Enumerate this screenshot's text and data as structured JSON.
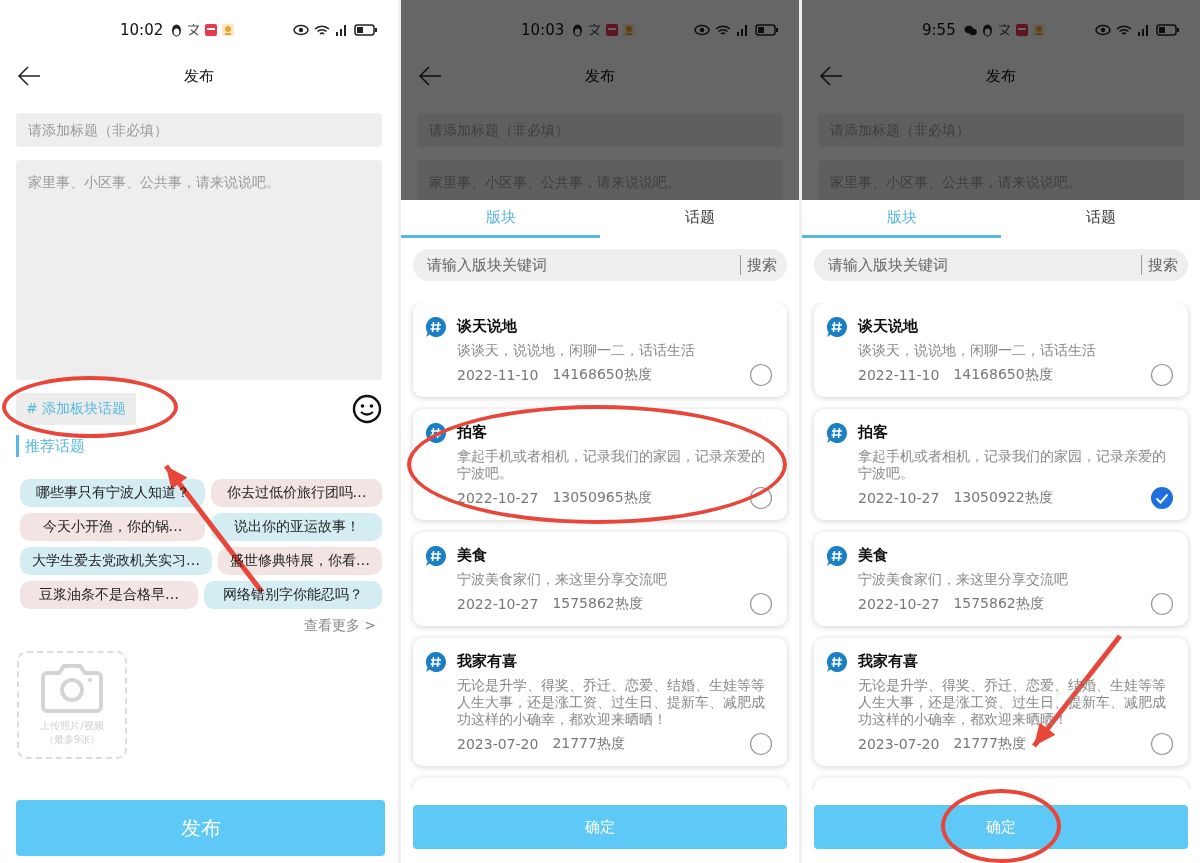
{
  "screens": [
    {
      "kind": "compose",
      "arrow": true,
      "status": {
        "time": "10:02",
        "notifications": [
          {
            "kind": "penguin"
          },
          {
            "kind": "translate"
          },
          {
            "kind": "news"
          },
          {
            "kind": "mascot"
          }
        ]
      },
      "header": {
        "title": "发布"
      },
      "title_field": {
        "placeholder": "请添加标题（非必填）"
      },
      "body_field": {
        "placeholder": "家里事、小区事、公共事，请来说说吧。"
      },
      "add_topic_button": {
        "label": "# 添加板块话题",
        "circled": true
      },
      "section_title": "推荐话题",
      "topic_rows": [
        [
          {
            "label": "哪些事只有宁波人知道？",
            "color": "#d4edf2"
          },
          {
            "label": "你去过低价旅行团吗…",
            "color": "#f3e4e4"
          }
        ],
        [
          {
            "label": "今天小开渔，你的锅…",
            "color": "#f3e4e4"
          },
          {
            "label": "说出你的亚运故事！",
            "color": "#d4edf2"
          }
        ],
        [
          {
            "label": "大学生爱去党政机关实习…",
            "color": "#d4edf2"
          },
          {
            "label": "盛世修典特展，你看…",
            "color": "#f3e4e4"
          }
        ],
        [
          {
            "label": "豆浆油条不是合格早…",
            "color": "#f3e4e4"
          },
          {
            "label": "网络错别字你能忍吗？",
            "color": "#d4edf2"
          }
        ]
      ],
      "more_link": "查看更多 >",
      "upload": {
        "line1": "上传照片/视频",
        "line2": "（最多9张）"
      },
      "publish_button": {
        "label": "发布"
      }
    },
    {
      "kind": "picker",
      "status": {
        "time": "10:03",
        "notifications": [
          {
            "kind": "penguin"
          },
          {
            "kind": "translate"
          },
          {
            "kind": "news"
          },
          {
            "kind": "mascot"
          }
        ]
      },
      "header": {
        "title": "发布"
      },
      "title_field": {
        "placeholder": "请添加标题（非必填）"
      },
      "body_field": {
        "placeholder": "家里事、小区事、公共事，请来说说吧。"
      },
      "tabs": [
        {
          "label": "版块",
          "selected": true
        },
        {
          "label": "话题",
          "selected": false
        }
      ],
      "search": {
        "placeholder": "请输入版块关键词",
        "button": "搜索"
      },
      "boards": [
        {
          "name": "谈天说地",
          "desc": "谈谈天，说说地，闲聊一二，话话生活",
          "date": "2022-11-10",
          "heat": "14168650热度",
          "selected": false,
          "circled": false
        },
        {
          "name": "拍客",
          "desc": "拿起手机或者相机，记录我们的家园，记录亲爱的宁波吧。",
          "date": "2022-10-27",
          "heat": "13050965热度",
          "selected": false,
          "circled": true
        },
        {
          "name": "美食",
          "desc": "宁波美食家们，来这里分享交流吧",
          "date": "2022-10-27",
          "heat": "1575862热度",
          "selected": false,
          "circled": false
        },
        {
          "name": "我家有喜",
          "desc": "无论是升学、得奖、乔迁、恋爱、结婚、生娃等等人生大事，还是涨工资、过生日、提新车、减肥成功这样的小确幸，都欢迎来晒晒！",
          "date": "2023-07-20",
          "heat": "21777热度",
          "selected": false,
          "circled": false
        }
      ],
      "confirm_button": {
        "label": "确定",
        "circled": false
      }
    },
    {
      "kind": "picker",
      "arrow": true,
      "status": {
        "time": "9:55",
        "notifications": [
          {
            "kind": "chat"
          },
          {
            "kind": "penguin"
          },
          {
            "kind": "translate"
          },
          {
            "kind": "news"
          },
          {
            "kind": "mascot"
          }
        ]
      },
      "header": {
        "title": "发布"
      },
      "title_field": {
        "placeholder": "请添加标题（非必填）"
      },
      "body_field": {
        "placeholder": "家里事、小区事、公共事，请来说说吧。"
      },
      "tabs": [
        {
          "label": "版块",
          "selected": true
        },
        {
          "label": "话题",
          "selected": false
        }
      ],
      "search": {
        "placeholder": "请输入版块关键词",
        "button": "搜索"
      },
      "boards": [
        {
          "name": "谈天说地",
          "desc": "谈谈天，说说地，闲聊一二，话话生活",
          "date": "2022-11-10",
          "heat": "14168650热度",
          "selected": false,
          "circled": false
        },
        {
          "name": "拍客",
          "desc": "拿起手机或者相机，记录我们的家园，记录亲爱的宁波吧。",
          "date": "2022-10-27",
          "heat": "13050922热度",
          "selected": true,
          "circled": false
        },
        {
          "name": "美食",
          "desc": "宁波美食家们，来这里分享交流吧",
          "date": "2022-10-27",
          "heat": "1575862热度",
          "selected": false,
          "circled": false
        },
        {
          "name": "我家有喜",
          "desc": "无论是升学、得奖、乔迁、恋爱、结婚、生娃等等人生大事，还是涨工资、过生日、提新车、减肥成功这样的小确幸，都欢迎来晒晒！",
          "date": "2023-07-20",
          "heat": "21777热度",
          "selected": false,
          "circled": false
        }
      ],
      "confirm_button": {
        "label": "确定",
        "circled": true
      }
    }
  ]
}
